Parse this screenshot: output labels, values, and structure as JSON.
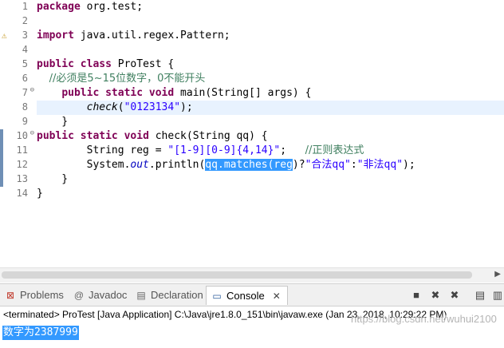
{
  "editor": {
    "line_numbers": [
      "1",
      "2",
      "3",
      "4",
      "5",
      "6",
      "7",
      "8",
      "9",
      "10",
      "11",
      "12",
      "13",
      "14"
    ],
    "lines": [
      {
        "id": "l1",
        "tokens": [
          {
            "t": "kw",
            "v": "package"
          },
          {
            "t": "n",
            "v": " org.test;"
          }
        ]
      },
      {
        "id": "l2",
        "tokens": []
      },
      {
        "id": "l3",
        "tokens": [
          {
            "t": "kw",
            "v": "import"
          },
          {
            "t": "n",
            "v": " java.util.regex.Pattern;"
          }
        ]
      },
      {
        "id": "l4",
        "tokens": []
      },
      {
        "id": "l5",
        "tokens": [
          {
            "t": "kw",
            "v": "public"
          },
          {
            "t": "n",
            "v": " "
          },
          {
            "t": "kw",
            "v": "class"
          },
          {
            "t": "n",
            "v": " ProTest {"
          }
        ]
      },
      {
        "id": "l6",
        "tokens": [
          {
            "t": "n",
            "v": "  "
          },
          {
            "t": "cmt",
            "v": "//必须是5~15位数字，0不能开头"
          }
        ]
      },
      {
        "id": "l7",
        "tokens": [
          {
            "t": "n",
            "v": "    "
          },
          {
            "t": "kw",
            "v": "public"
          },
          {
            "t": "n",
            "v": " "
          },
          {
            "t": "kw",
            "v": "static"
          },
          {
            "t": "n",
            "v": " "
          },
          {
            "t": "kw",
            "v": "void"
          },
          {
            "t": "n",
            "v": " main(String[] args) {"
          }
        ]
      },
      {
        "id": "l8",
        "tokens": [
          {
            "t": "n",
            "v": "        "
          },
          {
            "t": "ital",
            "v": "check"
          },
          {
            "t": "n",
            "v": "("
          },
          {
            "t": "str",
            "v": "\"0123134\""
          },
          {
            "t": "n",
            "v": ");"
          }
        ]
      },
      {
        "id": "l9",
        "tokens": [
          {
            "t": "n",
            "v": "    }"
          }
        ]
      },
      {
        "id": "l10",
        "tokens": [
          {
            "t": "kw",
            "v": "public"
          },
          {
            "t": "n",
            "v": " "
          },
          {
            "t": "kw",
            "v": "static"
          },
          {
            "t": "n",
            "v": " "
          },
          {
            "t": "kw",
            "v": "void"
          },
          {
            "t": "n",
            "v": " check(String qq) {"
          }
        ]
      },
      {
        "id": "l11",
        "tokens": [
          {
            "t": "n",
            "v": "        String reg = "
          },
          {
            "t": "str",
            "v": "\"[1-9][0-9]{4,14}\""
          },
          {
            "t": "n",
            "v": ";   "
          },
          {
            "t": "cmt",
            "v": "//正则表达式"
          }
        ]
      },
      {
        "id": "l12",
        "tokens": [
          {
            "t": "n",
            "v": "        System."
          },
          {
            "t": "sf",
            "v": "out"
          },
          {
            "t": "n",
            "v": ".println("
          },
          {
            "t": "sel",
            "v": "qq.matches(reg"
          },
          {
            "t": "n",
            "v": ")?"
          },
          {
            "t": "str",
            "v": "\"合法qq\""
          },
          {
            "t": "n",
            "v": ":"
          },
          {
            "t": "str",
            "v": "\"非法qq\""
          },
          {
            "t": "n",
            "v": ");"
          }
        ]
      },
      {
        "id": "l13",
        "tokens": [
          {
            "t": "n",
            "v": "    }"
          }
        ]
      },
      {
        "id": "l14",
        "tokens": [
          {
            "t": "n",
            "v": "}"
          }
        ]
      }
    ]
  },
  "console": {
    "tabs": [
      {
        "name": "problems",
        "label": "Problems",
        "icon": "problems-icon",
        "glyph": "⊠"
      },
      {
        "name": "javadoc",
        "label": "Javadoc",
        "icon": "javadoc-icon",
        "glyph": "@"
      },
      {
        "name": "declaration",
        "label": "Declaration",
        "icon": "declaration-icon",
        "glyph": "▤"
      },
      {
        "name": "console",
        "label": "Console",
        "icon": "console-icon",
        "glyph": "▭"
      }
    ],
    "terminated_line": "<terminated> ProTest [Java Application] C:\\Java\\jre1.8.0_151\\bin\\javaw.exe (Jan 23, 2018, 10:29:22 PM)",
    "output": "数字为2387999",
    "watermark": "https://blog.csdn.net/wuhui2100"
  },
  "colors": {
    "keyword": "#7f0055",
    "string": "#2a00ff",
    "comment": "#3f7f5f",
    "selection": "#3399ff"
  }
}
